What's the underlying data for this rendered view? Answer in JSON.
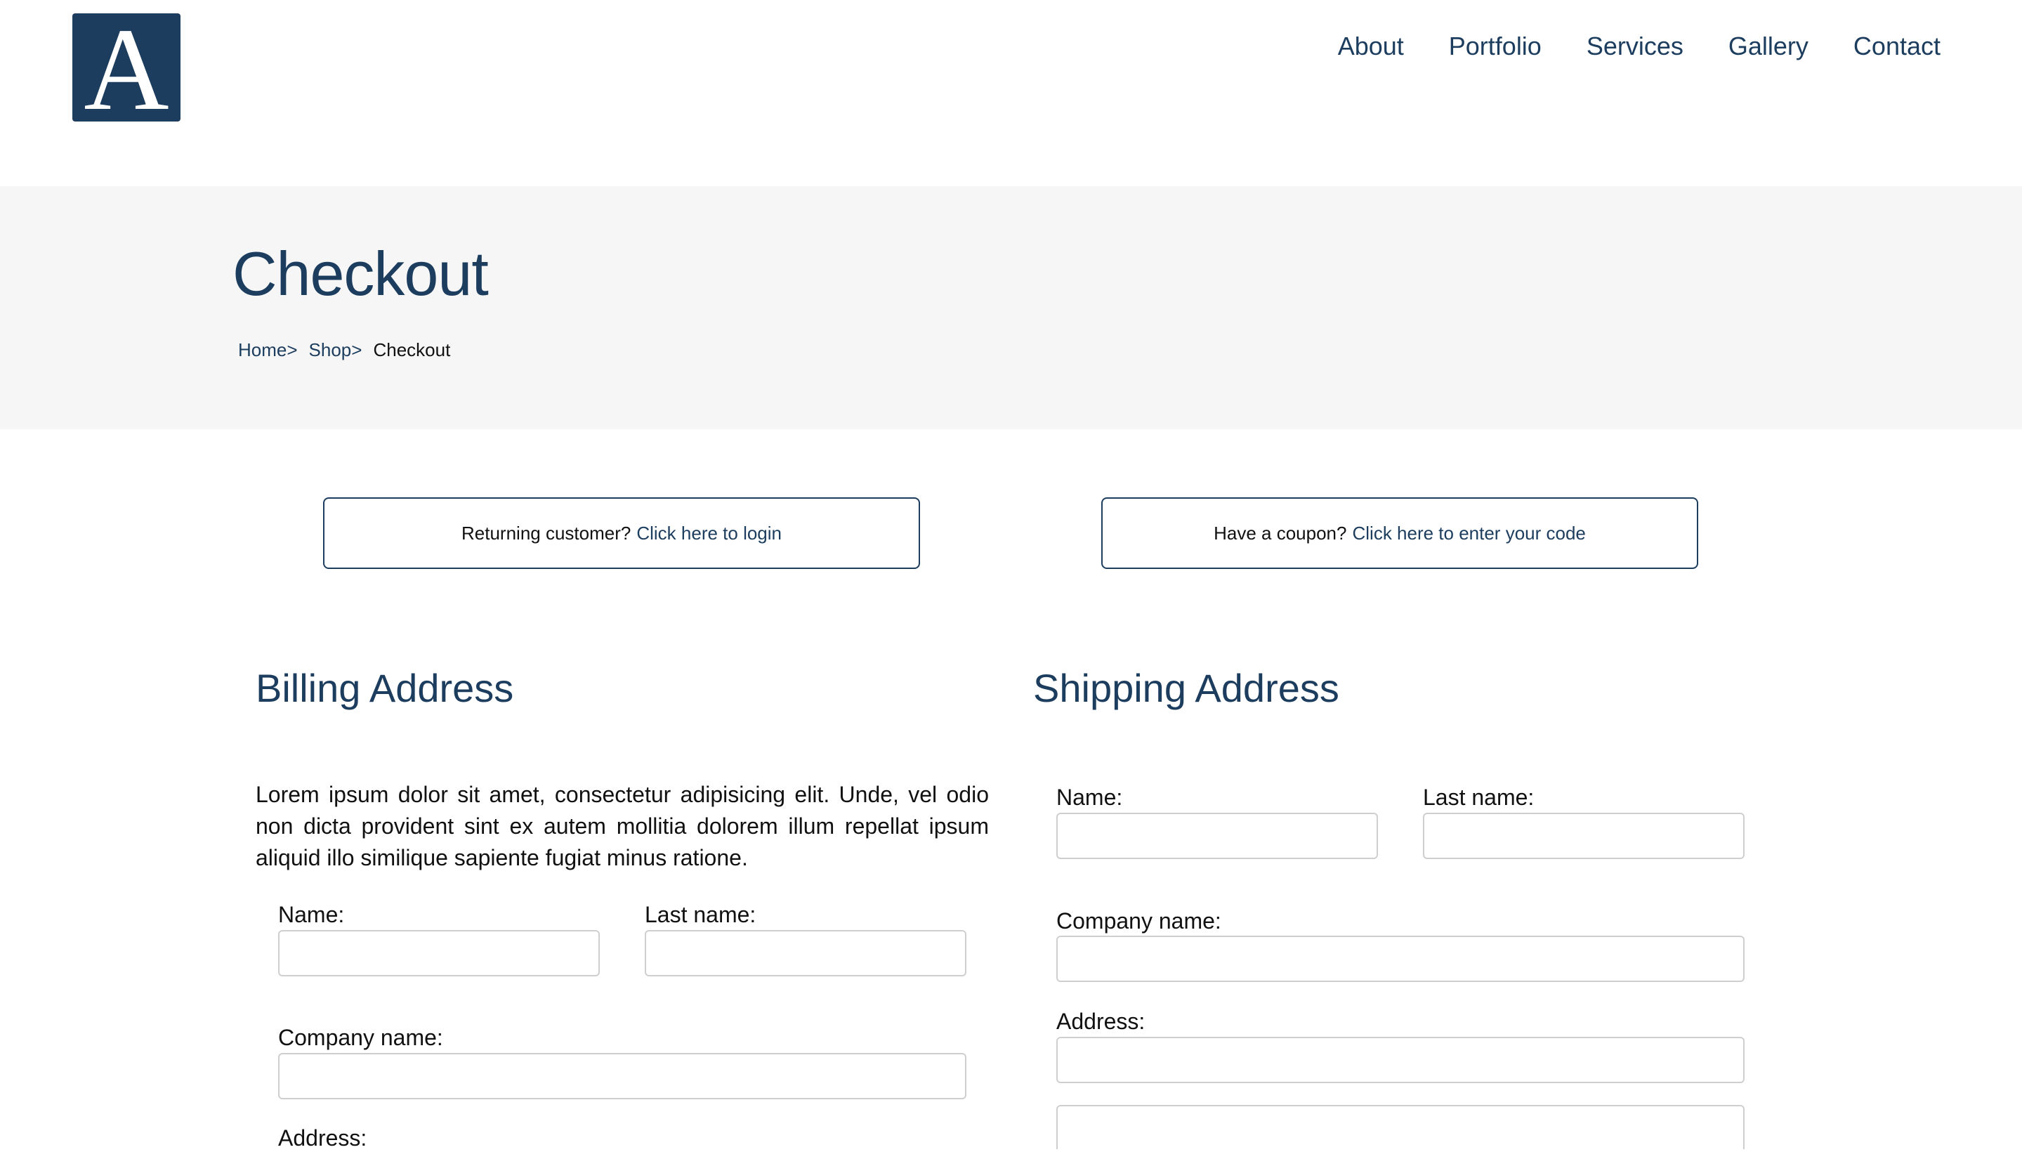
{
  "logo": {
    "letter": "A"
  },
  "nav": {
    "items": [
      "About",
      "Portfolio",
      "Services",
      "Gallery",
      "Contact"
    ]
  },
  "page": {
    "title": "Checkout"
  },
  "breadcrumb": {
    "home": "Home>",
    "shop": "Shop>",
    "current": "Checkout"
  },
  "notices": {
    "login": {
      "text": "Returning customer?",
      "link": "Click here to login"
    },
    "coupon": {
      "text": "Have a coupon?",
      "link": "Click here to enter your code"
    }
  },
  "billing": {
    "title": "Billing Address",
    "intro": "Lorem ipsum dolor sit amet, consectetur adipisicing elit. Unde, vel odio non dicta provident sint ex autem mollitia dolorem illum repellat ipsum aliquid illo similique sapiente fugiat minus ratione.",
    "name_label": "Name:",
    "last_name_label": "Last name:",
    "company_label": "Company name:",
    "address_label": "Address:"
  },
  "shipping": {
    "title": "Shipping Address",
    "name_label": "Name:",
    "last_name_label": "Last name:",
    "company_label": "Company name:",
    "address_label": "Address:"
  },
  "colors": {
    "primary": "#1c3d5e",
    "banner_bg": "#f6f6f6",
    "field_border": "#cfcfcf"
  }
}
